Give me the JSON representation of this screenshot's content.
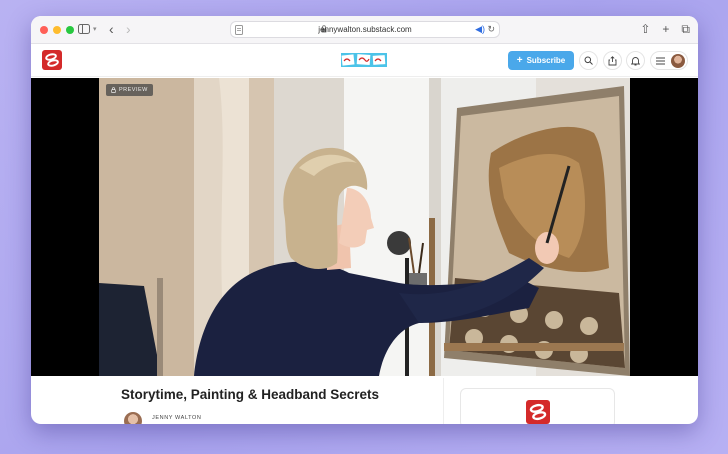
{
  "browser": {
    "url": "jennywalton.substack.com",
    "traffic_lights": [
      "#ff5f57",
      "#febc2e",
      "#28c840"
    ]
  },
  "header": {
    "subscribe_label": "Subscribe",
    "accent": "#4aa8ea",
    "brand_red": "#d42a2a",
    "icons": [
      "search-icon",
      "share-icon",
      "bell-icon",
      "menu-icon"
    ]
  },
  "video": {
    "badge_label": "PREVIEW"
  },
  "post": {
    "title": "Storytime, Painting & Headband Secrets",
    "author": "JENNY WALTON"
  }
}
